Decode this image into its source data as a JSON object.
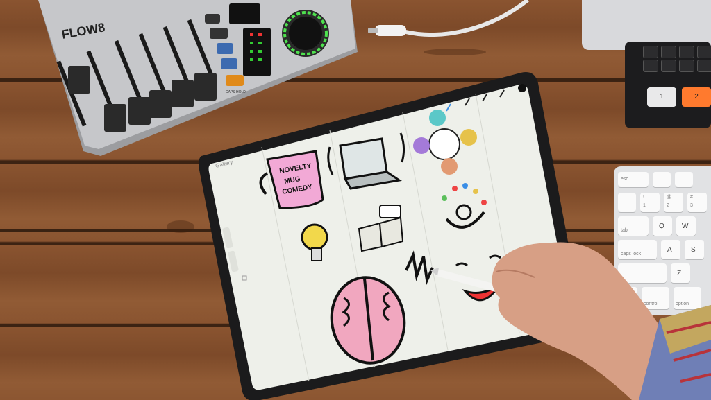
{
  "mixer": {
    "brand": "FLOW8",
    "knob_label": "CAPS HOLD"
  },
  "ipad": {
    "toolbar": {
      "gallery_label": "Gallery"
    }
  },
  "keyboard": {
    "keys": [
      "esc",
      "!",
      "1",
      "@",
      "2",
      "#",
      "3",
      "tab",
      "Q",
      "W",
      "caps lock",
      "A",
      "S",
      "Z",
      "control",
      "option"
    ]
  },
  "keypad": {
    "buttons": [
      "1",
      "2"
    ]
  }
}
